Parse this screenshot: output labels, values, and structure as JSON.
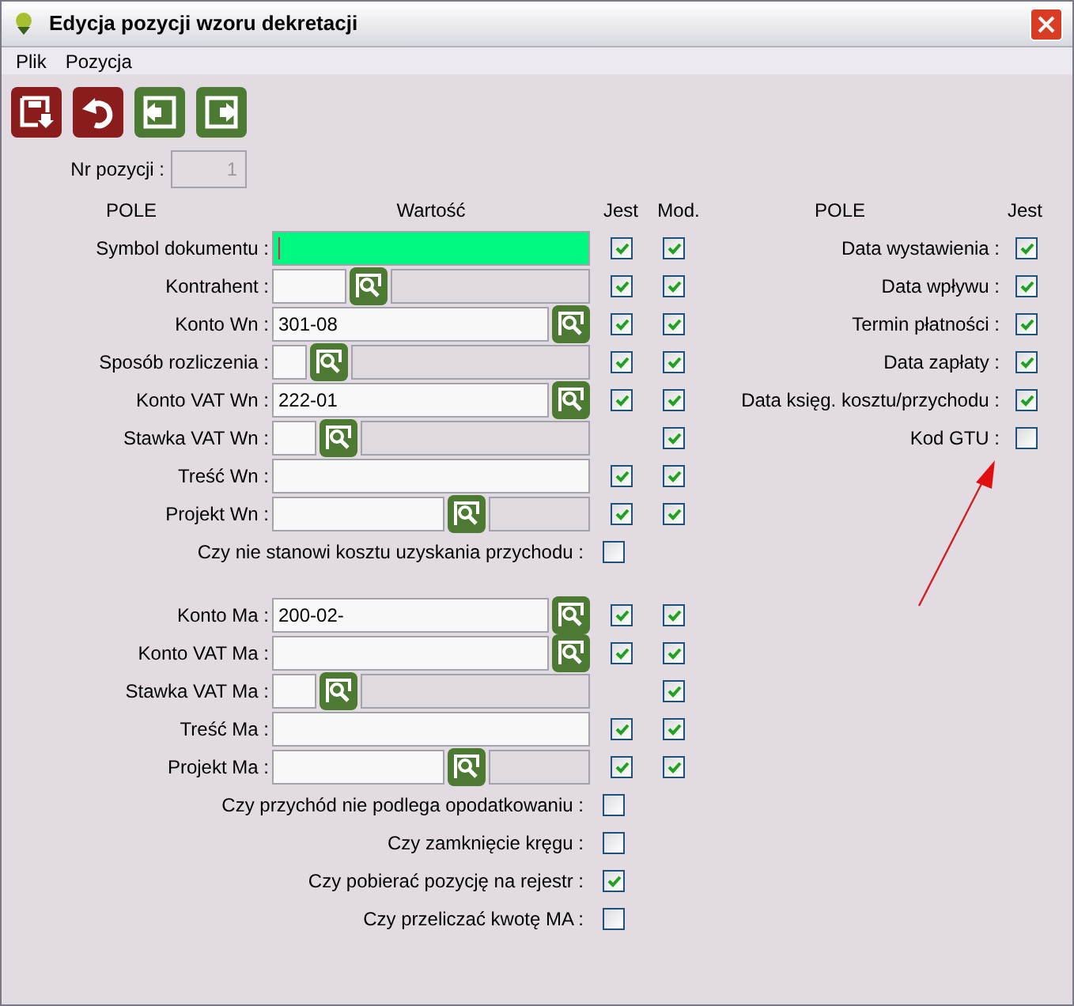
{
  "window": {
    "title": "Edycja pozycji wzoru dekretacji"
  },
  "menu": [
    {
      "label": "Plik"
    },
    {
      "label": "Pozycja"
    }
  ],
  "toolbar": [
    {
      "kind": "save"
    },
    {
      "kind": "undo"
    },
    {
      "kind": "prev"
    },
    {
      "kind": "next"
    }
  ],
  "position": {
    "label": "Nr pozycji :",
    "value": "1"
  },
  "left_headers": {
    "field": "POLE",
    "value": "Wartość",
    "present": "Jest",
    "modifiable": "Mod."
  },
  "wn_rows": [
    {
      "kind": "field",
      "label": "Symbol dokumentu :",
      "focused": true,
      "present": true,
      "modifiable": true
    },
    {
      "kind": "lookup-wide",
      "label": "Kontrahent :",
      "present": true,
      "modifiable": true
    },
    {
      "kind": "account",
      "label": "Konto Wn :",
      "value": "301-08",
      "present": true,
      "modifiable": true
    },
    {
      "kind": "lookup-tiny",
      "label": "Sposób rozliczenia :",
      "present": true,
      "modifiable": true
    },
    {
      "kind": "account",
      "label": "Konto VAT Wn :",
      "value": "222-01",
      "present": true,
      "modifiable": true
    },
    {
      "kind": "lookup",
      "label": "Stawka VAT Wn :",
      "modifiable": true
    },
    {
      "kind": "field",
      "label": "Treść Wn :",
      "focused": false,
      "present": true,
      "modifiable": true
    },
    {
      "kind": "project",
      "label": "Projekt Wn :",
      "present": true,
      "modifiable": true
    },
    {
      "kind": "flag",
      "label": "Czy nie stanowi kosztu uzyskania przychodu :",
      "checked": false
    }
  ],
  "ma_rows": [
    {
      "kind": "account",
      "label": "Konto Ma :",
      "value": "200-02-",
      "present": true,
      "modifiable": true
    },
    {
      "kind": "account",
      "label": "Konto VAT Ma :",
      "present": true,
      "modifiable": true
    },
    {
      "kind": "lookup",
      "label": "Stawka VAT Ma :",
      "modifiable": true
    },
    {
      "kind": "field",
      "label": "Treść Ma :",
      "focused": false,
      "present": true,
      "modifiable": true
    },
    {
      "kind": "project",
      "label": "Projekt Ma :",
      "present": true,
      "modifiable": true
    },
    {
      "kind": "flag",
      "label": "Czy przychód nie podlega opodatkowaniu :",
      "checked": false
    },
    {
      "kind": "flag",
      "label": "Czy zamknięcie kręgu :",
      "checked": false
    },
    {
      "kind": "flag",
      "label": "Czy pobierać pozycję na rejestr :",
      "checked": true
    },
    {
      "kind": "flag",
      "label": "Czy przeliczać kwotę MA :",
      "checked": false
    }
  ],
  "right_headers": {
    "field": "POLE",
    "present": "Jest"
  },
  "date_rows": [
    {
      "label": "Data wystawienia :",
      "checked": true
    },
    {
      "label": "Data wpływu :",
      "checked": true
    },
    {
      "label": "Termin płatności :",
      "checked": true
    },
    {
      "label": "Data zapłaty :",
      "checked": true
    },
    {
      "label": "Data księg. kosztu/przychodu :",
      "checked": true
    },
    {
      "label": "Kod GTU :",
      "checked": false
    }
  ]
}
